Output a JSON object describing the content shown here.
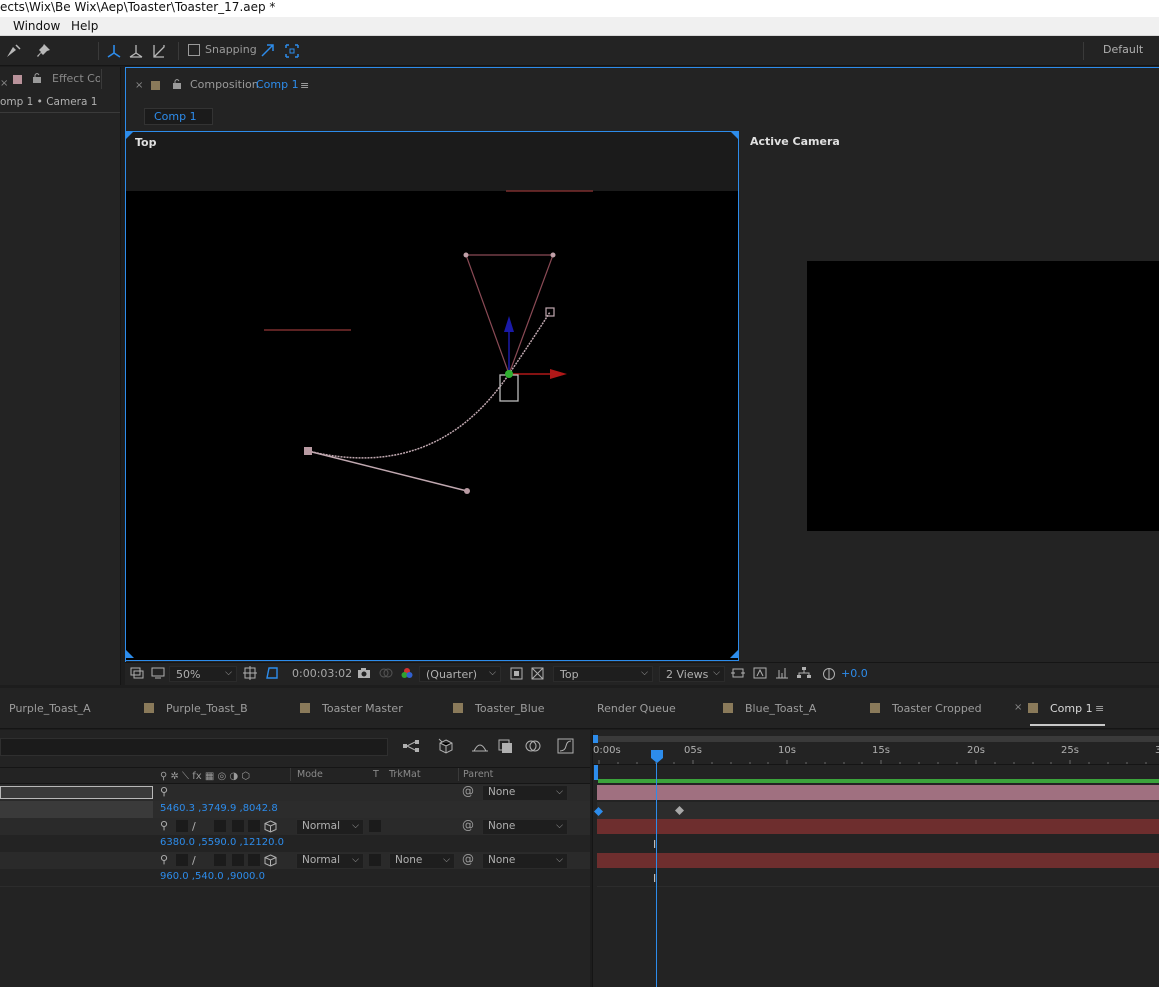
{
  "window": {
    "title": "ects\\Wix\\Be Wix\\Aep\\Toaster\\Toaster_17.aep *"
  },
  "menu": {
    "items": [
      "Window",
      "Help"
    ]
  },
  "toolbar": {
    "snapping_label": "Snapping",
    "workspace": "Default",
    "icons": [
      "pen-icon",
      "pin-icon",
      "local-axis-icon",
      "world-axis-icon",
      "view-axis-icon",
      "snap-feature-icon",
      "snap-icon"
    ]
  },
  "left_panel": {
    "tab_label": "Effect Con",
    "subtitle": "omp 1 • Camera 1"
  },
  "composition_panel": {
    "prefix": "Composition",
    "name": "Comp 1",
    "breadcrumb_tab": "Comp 1",
    "view_left_label": "Top",
    "view_right_label": "Active Camera"
  },
  "viewer_bar": {
    "zoom": "50%",
    "timecode": "0:00:03:02",
    "resolution": "(Quarter)",
    "view": "Top",
    "layout": "2 Views",
    "exposure": "+0.0"
  },
  "panel_tabs": [
    {
      "label": "Purple_Toast_A",
      "swatch": ""
    },
    {
      "label": "Purple_Toast_B",
      "swatch": "#8a7a5a"
    },
    {
      "label": "Toaster Master",
      "swatch": "#8a7a5a"
    },
    {
      "label": "Toaster_Blue",
      "swatch": "#8a7a5a"
    },
    {
      "label": "Render Queue",
      "swatch": ""
    },
    {
      "label": "Blue_Toast_A",
      "swatch": "#8a7a5a"
    },
    {
      "label": "Toaster Cropped",
      "swatch": "#8a7a5a"
    },
    {
      "label": "Comp 1",
      "swatch": "#8a7a5a",
      "active": true
    }
  ],
  "timeline": {
    "columns": {
      "mode": "Mode",
      "t": "T",
      "trkmat": "TrkMat",
      "parent": "Parent"
    },
    "layers": [
      {
        "parent": "None",
        "value": "5460.3 ,3749.9 ,8042.8"
      },
      {
        "mode": "Normal",
        "parent": "None",
        "value": "6380.0 ,5590.0 ,12120.0"
      },
      {
        "mode": "Normal",
        "trkmat": "None",
        "parent": "None",
        "value": "960.0 ,540.0 ,9000.0"
      }
    ],
    "ruler": [
      "0:00s",
      "05s",
      "10s",
      "15s",
      "20s",
      "25s",
      "3"
    ]
  },
  "colors": {
    "accent": "#2d8ceb",
    "layer_bar_camera": "#a07080",
    "layer_bar_red": "#6e2e2e",
    "work_area": "#3ba33b"
  }
}
